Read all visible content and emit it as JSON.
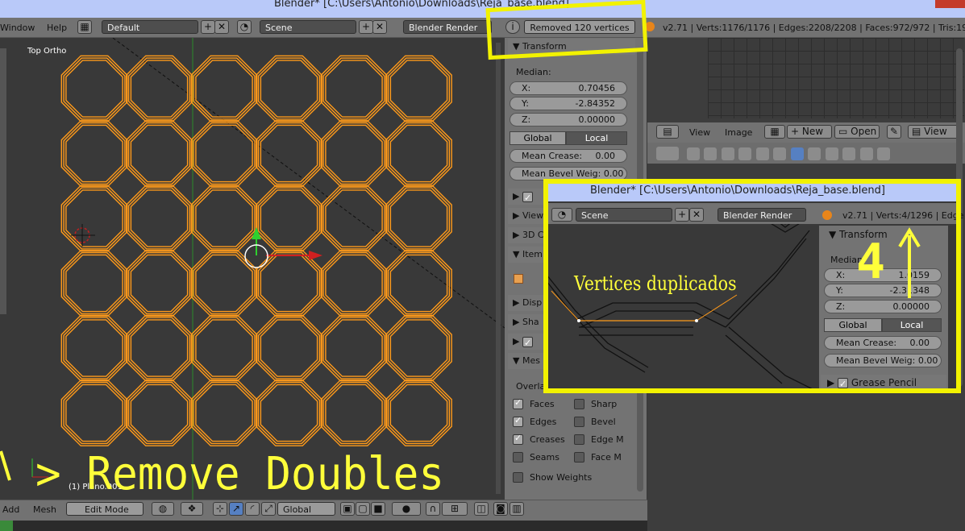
{
  "window": {
    "title": "Blender* [C:\\Users\\Antonio\\Downloads\\Reja_base.blend]"
  },
  "top_menu": {
    "window": "Window",
    "help": "Help"
  },
  "layout_select": "Default",
  "scene_select": "Scene",
  "render_engine": "Blender Render",
  "info_message": "Removed 120 vertices",
  "stats": "v2.71 | Verts:1176/1176 | Edges:2208/2208 | Faces:972/972 | Tris:1944",
  "viewport": {
    "label": "Top Ortho",
    "object_label": "(1) Plano.001"
  },
  "npanel": {
    "transform_header": "Transform",
    "median_label": "Median:",
    "x_label": "X:",
    "x_value": "0.70456",
    "y_label": "Y:",
    "y_value": "-2.84352",
    "z_label": "Z:",
    "z_value": "0.00000",
    "global": "Global",
    "local": "Local",
    "mean_crease_label": "Mean Crease:",
    "mean_crease_value": "0.00",
    "mean_bevel": "Mean Bevel Weig: 0.00",
    "sections": [
      "",
      "View",
      "3D C",
      "Item",
      "Disp",
      "Sha",
      "",
      "Mes"
    ],
    "overlays_label": "Overla",
    "options": [
      {
        "label": "Faces",
        "checked": true
      },
      {
        "label": "Sharp",
        "checked": false
      },
      {
        "label": "Edges",
        "checked": true
      },
      {
        "label": "Bevel",
        "checked": false
      },
      {
        "label": "Creases",
        "checked": true
      },
      {
        "label": "Edge M",
        "checked": false
      },
      {
        "label": "Seams",
        "checked": false
      },
      {
        "label": "Face M",
        "checked": false
      }
    ],
    "show_weights": "Show Weights"
  },
  "footer": {
    "add": "Add",
    "mesh": "Mesh",
    "mode": "Edit Mode",
    "orientation": "Global"
  },
  "image_editor": {
    "view": "View",
    "image": "Image",
    "new": "New",
    "open": "Open",
    "view2": "View"
  },
  "inset": {
    "title": "Blender* [C:\\Users\\Antonio\\Downloads\\Reja_base.blend]",
    "scene": "Scene",
    "render_engine": "Blender Render",
    "stats": "v2.71 | Verts:4/1296 | Edge",
    "transform_header": "Transform",
    "median_label": "Median",
    "x_label": "X:",
    "x_value": "1.0159",
    "y_label": "Y:",
    "y_value": "-2.31348",
    "z_label": "Z:",
    "z_value": "0.00000",
    "global": "Global",
    "local": "Local",
    "mean_crease_label": "Mean Crease:",
    "mean_crease_value": "0.00",
    "mean_bevel": "Mean Bevel Weig: 0.00",
    "grease_pencil": "Grease Pencil"
  },
  "annotations": {
    "duplicated": "Vertices duplicados",
    "remove_doubles": "> Remove Doubles",
    "number": "4"
  },
  "colors": {
    "highlight": "#f2f200",
    "mesh": "#ff9a1a",
    "title_bar": "#b9c9f9"
  }
}
